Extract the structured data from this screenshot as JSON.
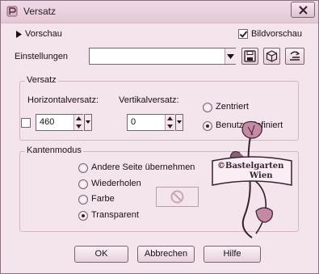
{
  "window": {
    "title": "Versatz"
  },
  "preview": {
    "toggle_label": "Vorschau",
    "checkbox_label": "Bildvorschau",
    "checked": true
  },
  "settings": {
    "label": "Einstellungen",
    "value": ""
  },
  "offset_group": {
    "title": "Versatz",
    "horizontal_label": "Horizontalversatz:",
    "vertical_label": "Vertikalversatz:",
    "horizontal_value": "460",
    "vertical_value": "0",
    "radio_centered": "Zentriert",
    "radio_custom": "Benutzerdefiniert",
    "selected": "custom"
  },
  "edge_group": {
    "title": "Kantenmodus",
    "options": [
      "Andere Seite übernehmen",
      "Wiederholen",
      "Farbe",
      "Transparent"
    ],
    "selected": "Transparent"
  },
  "watermark": {
    "text_line1": "©Bastelgarten",
    "text_line2": "Wien"
  },
  "buttons": {
    "ok": "OK",
    "cancel": "Abbrechen",
    "help": "Hilfe"
  },
  "colors": {
    "dialog_bg": "#f4e4ec",
    "border": "#7a6270",
    "text": "#1a0f16"
  }
}
